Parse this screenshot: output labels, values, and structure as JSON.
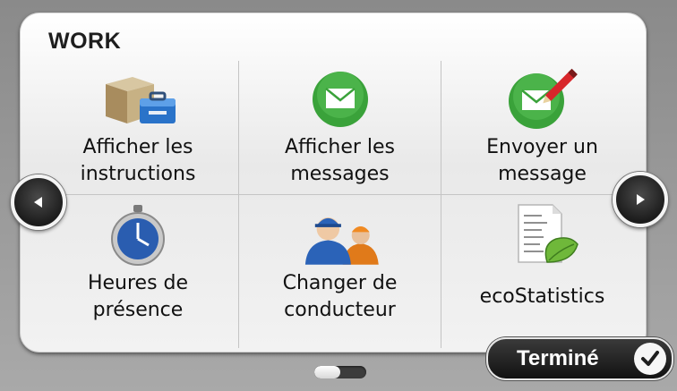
{
  "screen": {
    "title": "WORK"
  },
  "menu": {
    "items": [
      {
        "label": "Afficher les\ninstructions",
        "icon": "toolbox-icon"
      },
      {
        "label": "Afficher les\nmessages",
        "icon": "envelope-icon"
      },
      {
        "label": "Envoyer un\nmessage",
        "icon": "envelope-pencil-icon"
      },
      {
        "label": "Heures de\nprésence",
        "icon": "stopwatch-icon"
      },
      {
        "label": "Changer de\nconducteur",
        "icon": "drivers-icon"
      },
      {
        "label": "ecoStatistics",
        "icon": "eco-statistics-icon"
      }
    ]
  },
  "nav": {
    "previous_icon": "arrow-left-icon",
    "next_icon": "arrow-right-icon"
  },
  "footer": {
    "done_label": "Terminé",
    "done_icon": "checkmark-icon"
  },
  "pager": {
    "current_page": 1,
    "page_count": 2
  },
  "colors": {
    "accent_green": "#3aa23a",
    "panel_dark": "#1c1c1c",
    "clock_blue": "#2a5db0"
  }
}
